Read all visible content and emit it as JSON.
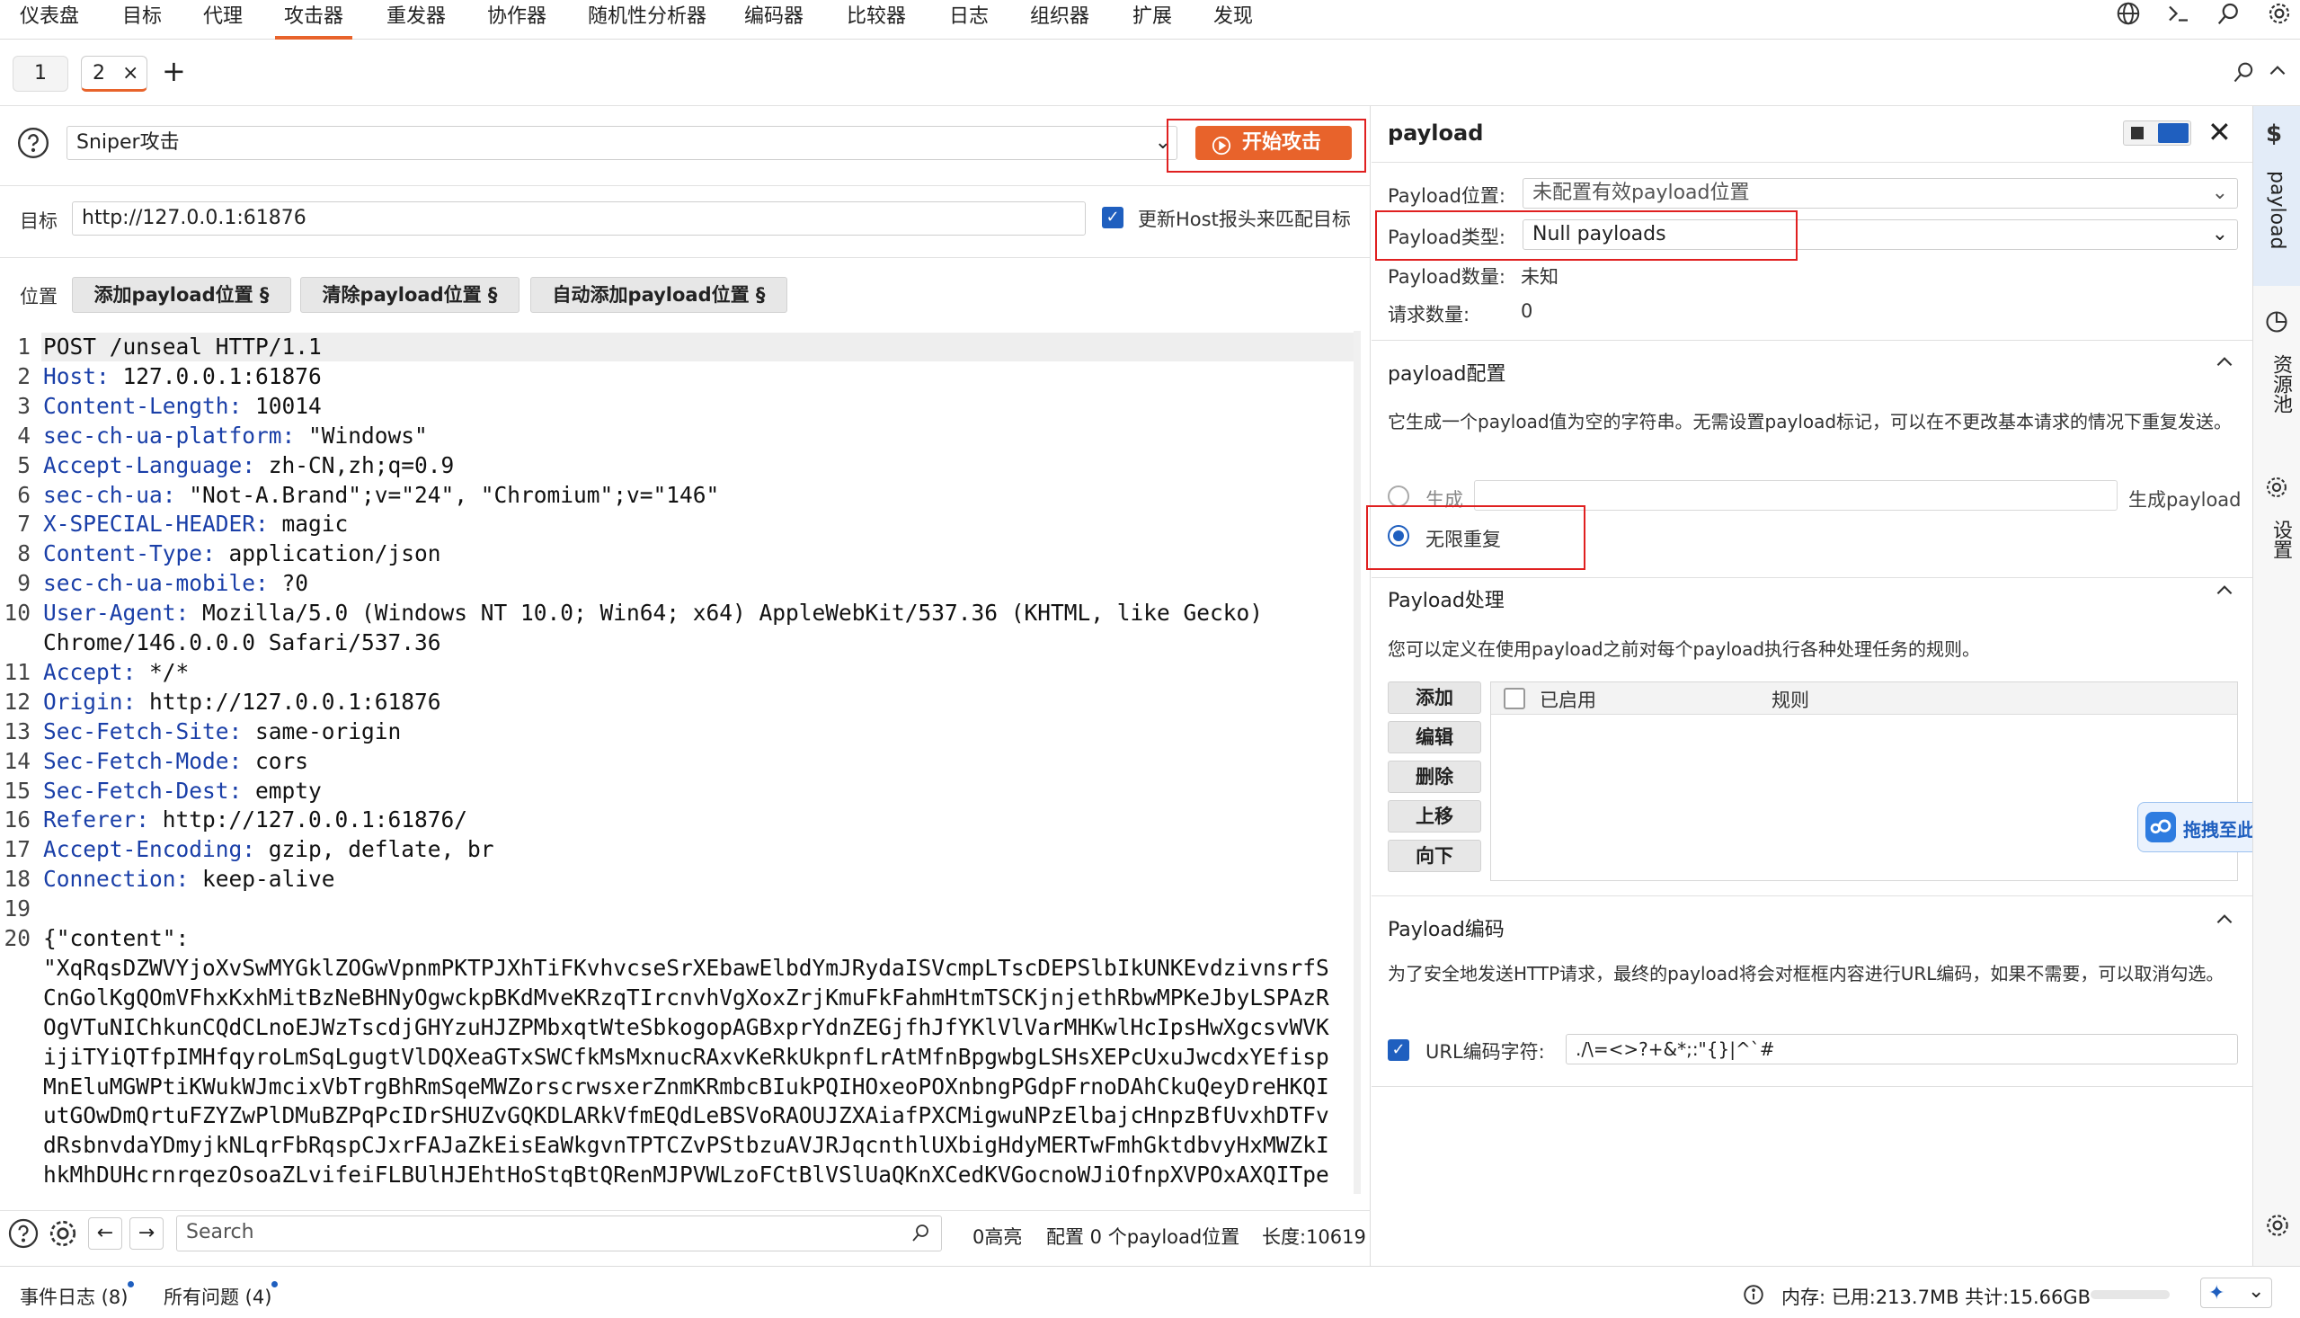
{
  "menu": [
    "仪表盘",
    "目标",
    "代理",
    "攻击器",
    "重发器",
    "协作器",
    "随机性分析器",
    "编码器",
    "比较器",
    "日志",
    "组织器",
    "扩展",
    "发现"
  ],
  "tabs": [
    {
      "label": "1"
    },
    {
      "label": "2",
      "close": "×"
    }
  ],
  "add_tab": "+",
  "attack_type": "Sniper攻击",
  "start_attack": "开始攻击",
  "target_label": "目标",
  "target_url": "http://127.0.0.1:61876",
  "update_host_label": "更新Host报头来匹配目标",
  "positions_label": "位置",
  "add_payload_pos": "添加payload位置 §",
  "clear_payload_pos": "清除payload位置 §",
  "auto_payload_pos": "自动添加payload位置 §",
  "request_lines": [
    {
      "n": "1",
      "key": "",
      "val": "POST /unseal HTTP/1.1"
    },
    {
      "n": "2",
      "key": "Host:",
      "val": " 127.0.0.1:61876"
    },
    {
      "n": "3",
      "key": "Content-Length:",
      "val": " 10014"
    },
    {
      "n": "4",
      "key": "sec-ch-ua-platform:",
      "val": " \"Windows\""
    },
    {
      "n": "5",
      "key": "Accept-Language:",
      "val": " zh-CN,zh;q=0.9"
    },
    {
      "n": "6",
      "key": "sec-ch-ua:",
      "val": " \"Not-A.Brand\";v=\"24\", \"Chromium\";v=\"146\""
    },
    {
      "n": "7",
      "key": "X-SPECIAL-HEADER:",
      "val": " magic"
    },
    {
      "n": "8",
      "key": "Content-Type:",
      "val": " application/json"
    },
    {
      "n": "9",
      "key": "sec-ch-ua-mobile:",
      "val": " ?0"
    },
    {
      "n": "10",
      "key": "User-Agent:",
      "val": " Mozilla/5.0 (Windows NT 10.0; Win64; x64) AppleWebKit/537.36 (KHTML, like Gecko)"
    },
    {
      "n": "",
      "key": "",
      "val": "Chrome/146.0.0.0 Safari/537.36"
    },
    {
      "n": "11",
      "key": "Accept:",
      "val": " */*"
    },
    {
      "n": "12",
      "key": "Origin:",
      "val": " http://127.0.0.1:61876"
    },
    {
      "n": "13",
      "key": "Sec-Fetch-Site:",
      "val": " same-origin"
    },
    {
      "n": "14",
      "key": "Sec-Fetch-Mode:",
      "val": " cors"
    },
    {
      "n": "15",
      "key": "Sec-Fetch-Dest:",
      "val": " empty"
    },
    {
      "n": "16",
      "key": "Referer:",
      "val": " http://127.0.0.1:61876/"
    },
    {
      "n": "17",
      "key": "Accept-Encoding:",
      "val": " gzip, deflate, br"
    },
    {
      "n": "18",
      "key": "Connection:",
      "val": " keep-alive"
    },
    {
      "n": "19",
      "key": "",
      "val": ""
    },
    {
      "n": "20",
      "key": "{\"content\":",
      "val": ""
    }
  ],
  "body_lines": [
    "\"XqRqsDZWVYjoXvSwMYGklZOGwVpnmPKTPJXhTiFKvhvcseSrXEbawElbdYmJRydaISVcmpLTscDEPSlbIkUNKEvdzivnsrfS",
    "CnGolKgQOmVFhxKxhMitBzNeBHNyOgwckpBKdMveKRzqTIrcnvhVgXoxZrjKmuFkFahmHtmTSCKjnjethRbwMPKeJbyLSPAzR",
    "OgVTuNIChkunCQdCLnoEJWzTscdjGHYzuHJZPMbxqtWteSbkogopAGBxprYdnZEGjfhJfYKlVlVarMHKwlHcIpsHwXgcsvWVK",
    "ijiTYiQTfpIMHfqyroLmSqLgugtVlDQXeaGTxSWCfkMsMxnucRAxvKeRkUkpnfLrAtMfnBpgwbgLSHsXEPcUxuJwcdxYEfisp",
    "MnEluMGWPtiKWukWJmcixVbTrgBhRmSqeMWZorscrwsxerZnmKRmbcBIukPQIHOxeoPOXnbngPGdpFrnoDAhCkuQeyDreHKQI",
    "utGOwDmQrtuFZYZwPlDMuBZPqPcIDrSHUZvGQKDLARkVfmEQdLeBSVoRAOUJZXAiafPXCMigwuNPzElbajcHnpzBfUvxhDTFv",
    "dRsbnvdaYDmyjkNLqrFbRqspCJxrFAJaZkEisEaWkgvnTPTCZvPStbzuAVJRJqcnthlUXbigHdyMERTwFmhGktdbvyHxMWZkI",
    "hkMhDUHcrnrqezOsoaZLvifeiFLBUlHJEhtHoStqBtQRenMJPVWLzoFCtBlVSlUaQKnXCedKVGocnoWJiOfnpXVPOxAXQITpe"
  ],
  "search_placeholder": "Search",
  "highlights": "0高亮",
  "config_positions": "配置 0 个payload位置",
  "length": "长度:10619",
  "payload_panel": {
    "title": "payload",
    "position_label": "Payload位置:",
    "position_value": "未配置有效payload位置",
    "type_label": "Payload类型:",
    "type_value": "Null payloads",
    "count_label": "Payload数量:",
    "count_value": "未知",
    "requests_label": "请求数量:",
    "requests_value": "0",
    "config_title": "payload配置",
    "config_desc": "它生成一个payload值为空的字符串。无需设置payload标记，可以在不更改基本请求的情况下重复发送。",
    "generate_label": "生成",
    "generate_suffix": "生成payload",
    "infinite_label": "无限重复",
    "processing_title": "Payload处理",
    "processing_desc": "您可以定义在使用payload之前对每个payload执行各种处理任务的规则。",
    "proc_buttons": [
      "添加",
      "编辑",
      "删除",
      "上移",
      "向下"
    ],
    "col_enabled": "已启用",
    "col_rule": "规则",
    "upload_label": "拖拽至此上传",
    "encoding_title": "Payload编码",
    "encoding_desc": "为了安全地发送HTTP请求，最终的payload将会对框框内容进行URL编码，如果不需要，可以取消勾选。",
    "url_encode_label": "URL编码字符:",
    "url_encode_value": "./\\=<>?+&*;:\"{}|^`#"
  },
  "side_rail": [
    "payload",
    "资源池",
    "设置"
  ],
  "status": {
    "event_log": "事件日志 (8)",
    "all_issues": "所有问题 (4)",
    "memory": "内存: 已用:213.7MB 共计:15.66GB"
  },
  "colors": {
    "accent": "#e8632b",
    "key": "#1a3fa8",
    "string": "#1a8a2a",
    "highlight_box": "#e02020"
  }
}
